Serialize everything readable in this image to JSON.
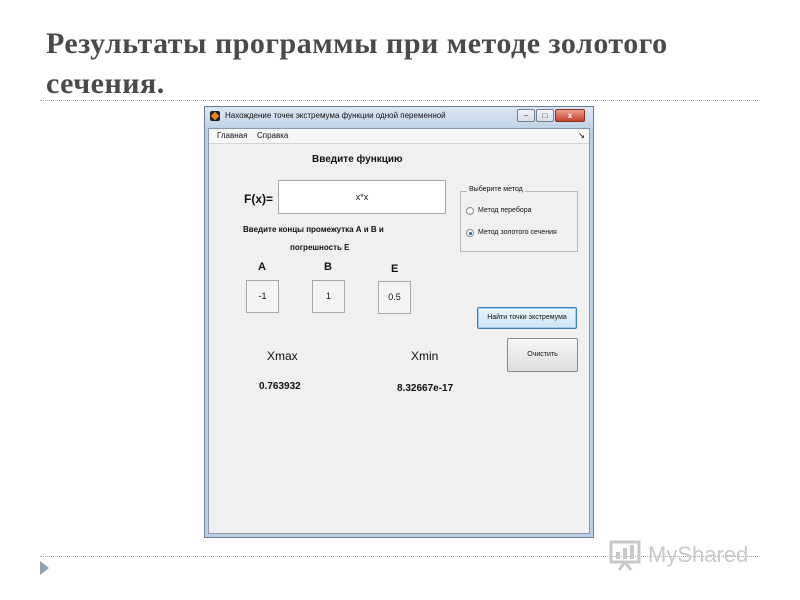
{
  "slide": {
    "title": "Результаты программы при методе золотого сечения.",
    "logo_text": "MyShared"
  },
  "window": {
    "title": "Нахождение точек экстремума функции одной переменной",
    "controls": {
      "minimize": "–",
      "maximize": "□",
      "close": "x"
    },
    "menu": [
      "Главная",
      "Справка"
    ],
    "menu_arrow": "↘"
  },
  "form": {
    "heading": "Введите функцию",
    "function_label": "F(x)=",
    "function_value": "x*x",
    "interval_text_1": "Введите концы промежутка А и В и",
    "interval_text_2": "погрешность Е",
    "a_label": "A",
    "b_label": "B",
    "e_label": "E",
    "a_value": "-1",
    "b_value": "1",
    "e_value": "0.5",
    "method_group": {
      "title": "Выберите метод",
      "options": [
        "Метод перебора",
        "Метод золотого сечения"
      ],
      "selected": "Метод золотого сечения"
    },
    "find_button": "Найти точки экстремума",
    "clear_button": "Очистить",
    "xmax_label": "Xmax",
    "xmin_label": "Xmin",
    "xmax_value": "0.763932",
    "xmin_value": "8.32667e-17"
  }
}
